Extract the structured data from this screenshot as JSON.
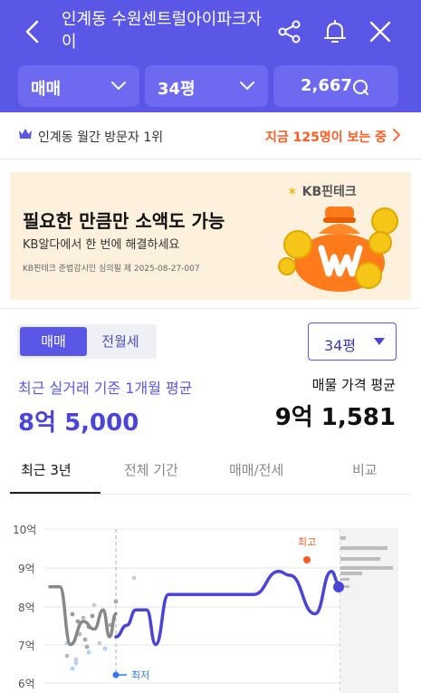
{
  "header": {
    "title": "인계동 수원센트럴아이파크자이",
    "back_icon": "chevron-left-icon",
    "share_icon": "share-icon",
    "bell_icon": "bell-icon",
    "close_icon": "close-icon",
    "bg_color": "#5b57e6"
  },
  "filters": {
    "trade_type": "매매",
    "area": "34평",
    "listing_count": "2,667"
  },
  "rank": {
    "text": "인계동 월간 방문자 1위",
    "viewers": "지금 125명이 보는 중"
  },
  "ad": {
    "brand": "KB핀테크",
    "title": "필요한 만큼만 소액도 가능",
    "subtitle": "KB알다에서 한 번에 해결하세요",
    "fine_print": "KB핀테크 준법감시인 심의필 제 2025-08-27-007"
  },
  "toggle": {
    "options": [
      "매매",
      "전월세"
    ],
    "selected": "매매"
  },
  "size_select": "34평",
  "summary": {
    "avg_label": "최근 실거래 기준 1개월 평균",
    "avg_value": "8억 5,000",
    "listing_label": "매물 가격 평균",
    "listing_value": "9억 1,581"
  },
  "tabs": [
    {
      "label": "최근 3년",
      "active": true
    },
    {
      "label": "전체 기간",
      "active": false
    },
    {
      "label": "매매/전세",
      "active": false
    },
    {
      "label": "비교",
      "active": false
    }
  ],
  "chart_data": {
    "type": "line",
    "y_ticks": [
      "10억",
      "9억",
      "8억",
      "7억",
      "6억"
    ],
    "ylim": [
      6,
      10
    ],
    "unit": "억",
    "markers": {
      "high": "최고",
      "low": "최저"
    },
    "series": [
      {
        "color": "#888888",
        "values": [
          8.5,
          8.5,
          7.0,
          7.6,
          7.4,
          7.9,
          7.2,
          7.8
        ]
      },
      {
        "color": "#4a45d8",
        "values": [
          7.2,
          7.5,
          7.9,
          7.9,
          7.0,
          8.3,
          8.3,
          8.3,
          8.3,
          8.9,
          8.8,
          7.8,
          8.9,
          8.6
        ]
      }
    ],
    "high_value": 9.3,
    "low_value": 6.2,
    "accent_high": "#ff5a1f",
    "accent_low": "#2f7be6"
  }
}
